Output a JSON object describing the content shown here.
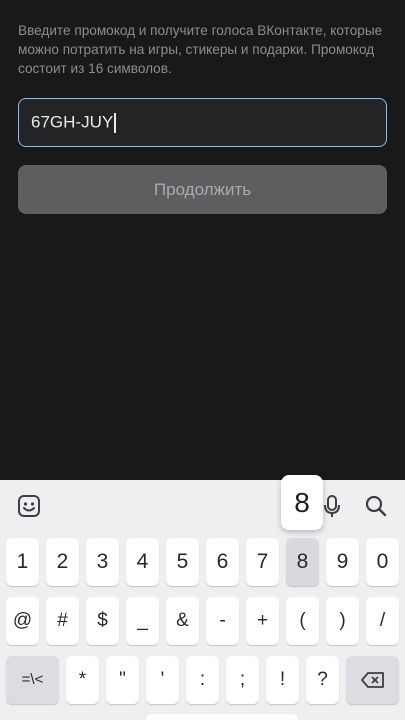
{
  "promo": {
    "description": "Введите промокод и получите голоса ВКонтакте, которые можно потратить на игры, стикеры и подарки. Промокод состоит из 16 символов.",
    "code_value": "67GH-JUY",
    "continue_label": "Продолжить"
  },
  "keyboard": {
    "toolbar_icons": [
      "emoji-icon",
      "microphone-icon",
      "search-icon"
    ],
    "popup_key": "8",
    "rows": [
      [
        "1",
        "2",
        "3",
        "4",
        "5",
        "6",
        "7",
        "8",
        "9",
        "0"
      ],
      [
        "@",
        "#",
        "$",
        "_",
        "&",
        "-",
        "+",
        "(",
        ")",
        "/"
      ],
      [
        "=\\<",
        "*",
        "\"",
        "'",
        ":",
        ";",
        "!",
        "?",
        "backspace-icon"
      ]
    ],
    "colors": {
      "background": "#19191a",
      "input_border": "#9db7d6",
      "button_bg": "#5d5e5f",
      "keyboard_bg": "#eeeff1"
    }
  }
}
